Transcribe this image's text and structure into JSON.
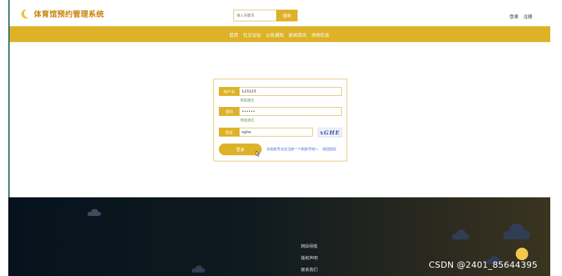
{
  "header": {
    "site_title": "体育馆预约管理系统",
    "search_placeholder": "输入关键词",
    "search_button": "搜索",
    "login_link": "登录",
    "register_link": "注册"
  },
  "nav": {
    "items": [
      "首页",
      "社交论坛",
      "公告通知",
      "新闻资讯",
      "场地信息"
    ]
  },
  "login_form": {
    "username_label": "用户名",
    "username_value": "123123",
    "username_hint": "校验通过",
    "password_label": "密码",
    "password_value": "••••••",
    "password_hint": "校验通过",
    "captcha_label": "验证",
    "captcha_value": "xghe",
    "captcha_image_text": "xGHE",
    "login_button": "登录",
    "register_link": "没有账号点击注册一个新账号吧～",
    "forgot_link": "找回密码"
  },
  "footer": {
    "links": [
      "网站导航",
      "版权声明",
      "联系我们"
    ]
  },
  "watermark": "CSDN @2401_85644395",
  "colors": {
    "accent": "#ddb228",
    "title": "#c8820a",
    "hint": "#5a9a4a",
    "link": "#4a6fd4"
  }
}
